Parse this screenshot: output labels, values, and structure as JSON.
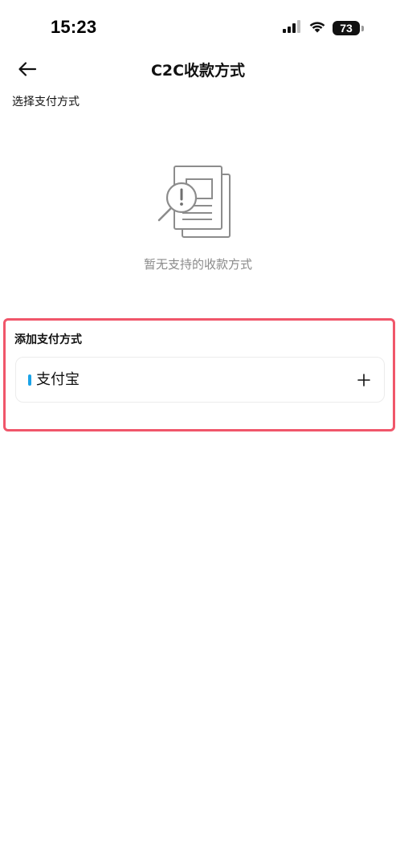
{
  "status_bar": {
    "time": "15:23",
    "battery_level": "73",
    "icons": [
      "cellular-signal-icon",
      "wifi-icon",
      "battery-icon"
    ]
  },
  "nav": {
    "back_icon": "arrow-left-icon",
    "title": "C2C收款方式"
  },
  "select_section": {
    "label": "选择支付方式"
  },
  "empty_state": {
    "icon": "document-search-alert-icon",
    "message": "暂无支持的收款方式"
  },
  "add_section": {
    "label": "添加支付方式",
    "methods": [
      {
        "label": "支付宝",
        "marker_color": "#1AA3E8",
        "action_icon": "plus-icon"
      }
    ]
  },
  "colors": {
    "highlight_border": "#F0566A",
    "alipay_marker": "#1AA3E8",
    "muted_text": "#8A8A8A"
  }
}
